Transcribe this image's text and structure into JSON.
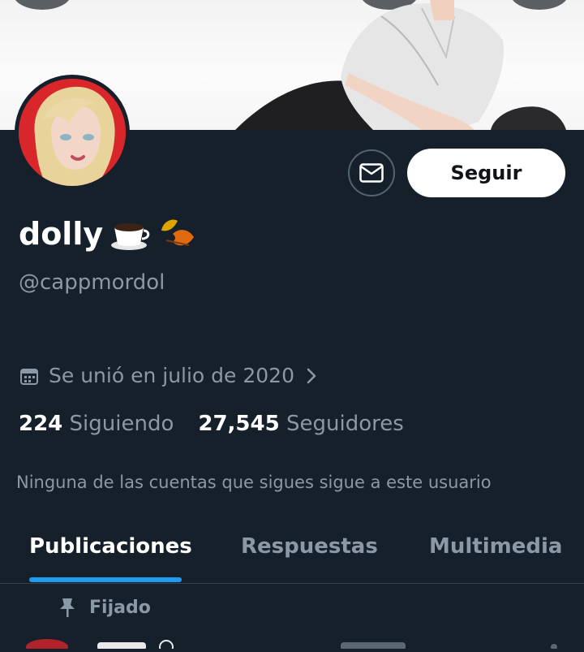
{
  "profile": {
    "name": "dolly",
    "handle": "@cappmordol",
    "joined": "Se unió en julio de 2020",
    "following_count": "224",
    "following_label": "Siguiendo",
    "followers_count": "27,545",
    "followers_label": "Seguidores",
    "mutual_text": "Ninguna de las cuentas que sigues sigue a este usuario"
  },
  "actions": {
    "follow_label": "Seguir",
    "message_icon": "mail-icon"
  },
  "tabs": [
    {
      "label": "Publicaciones",
      "active": true
    },
    {
      "label": "Respuestas",
      "active": false
    },
    {
      "label": "Multimedia",
      "active": false
    }
  ],
  "pinned": {
    "label": "Fijado"
  },
  "colors": {
    "background": "#15202b",
    "accent": "#1d9bf0",
    "muted_text": "#8b98a5"
  }
}
